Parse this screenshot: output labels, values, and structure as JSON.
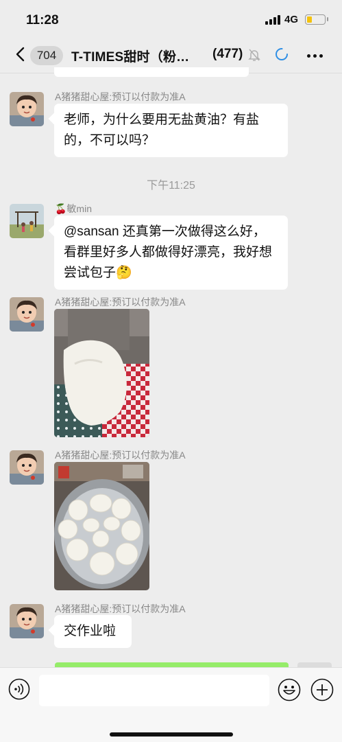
{
  "status_bar": {
    "time": "11:28",
    "network": "4G",
    "battery_fraction": 0.25
  },
  "nav": {
    "back_badge": "704",
    "title": "T-TIMES甜时（粉…",
    "member_count": "(477)"
  },
  "messages": [
    {
      "sender": "A猪猪甜心屋:预订以付款为准A",
      "text": "老师，为什么要用无盐黄油？有盐的，不可以吗？"
    },
    {
      "sender": "🍒敏min",
      "text": "@sansan 还真第一次做得这么好，看群里好多人都做得好漂亮，我好想尝试包子🤔"
    },
    {
      "sender": "A猪猪甜心屋:预订以付款为准A"
    },
    {
      "sender": "A猪猪甜心屋:预订以付款为准A"
    },
    {
      "sender": "A猪猪甜心屋:预订以付款为准A",
      "text": "交作业啦"
    }
  ],
  "timestamp": "下午11:25",
  "input": {
    "placeholder": ""
  },
  "colors": {
    "background": "#ededed",
    "self_bubble": "#95ec69",
    "battery": "#f4c20d"
  },
  "icons": [
    "back-chevron-icon",
    "mute-bell-icon",
    "loading-icon",
    "more-icon",
    "voice-icon",
    "emoji-icon",
    "plus-icon"
  ]
}
